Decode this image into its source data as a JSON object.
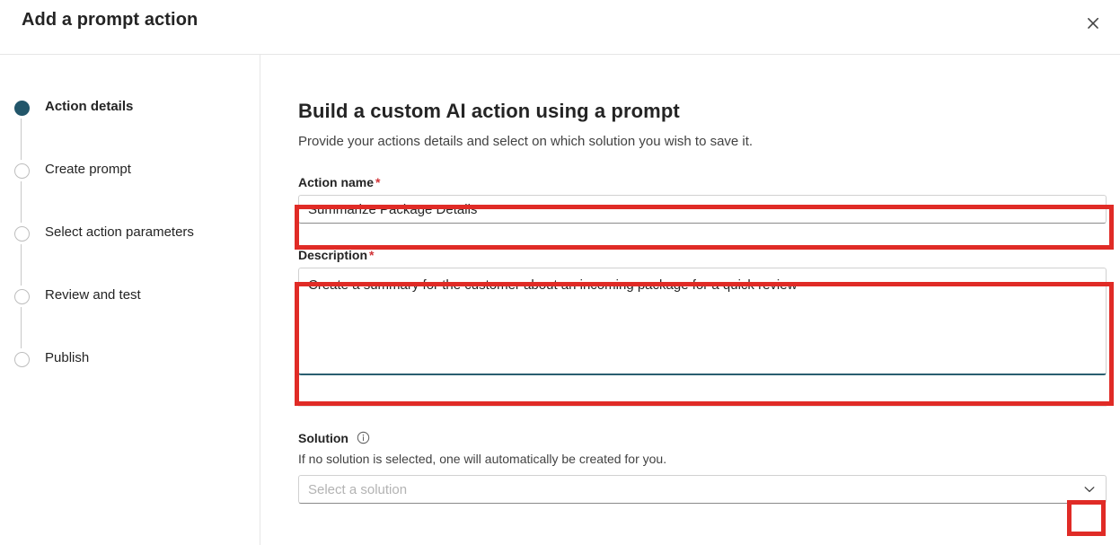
{
  "dialog": {
    "title": "Add a prompt action",
    "close_icon": "close-icon",
    "close_label": "Close"
  },
  "wizard": {
    "steps": [
      {
        "label": "Action details",
        "state": "active"
      },
      {
        "label": "Create prompt",
        "state": "pending"
      },
      {
        "label": "Select action parameters",
        "state": "pending"
      },
      {
        "label": "Review and test",
        "state": "pending"
      },
      {
        "label": "Publish",
        "state": "pending"
      }
    ]
  },
  "main": {
    "heading": "Build a custom AI action using a prompt",
    "subheading": "Provide your actions details and select on which solution you wish to save it.",
    "action_name": {
      "label": "Action name",
      "required_mark": "*",
      "value": "Summarize Package Details",
      "placeholder": ""
    },
    "description": {
      "label": "Description",
      "required_mark": "*",
      "value": "Create a summary for the customer about an incoming package for a quick review",
      "placeholder": ""
    },
    "solution": {
      "label": "Solution",
      "info_icon": "info-icon",
      "helper_text": "If no solution is selected, one will automatically be created for you.",
      "selected_value": "Select a solution",
      "chevron_icon": "chevron-down-icon"
    }
  },
  "annotations": {
    "color": "#e02b26",
    "highlighted": [
      "action-name-input",
      "description-textarea",
      "solution-dropdown-chevron"
    ]
  },
  "colors": {
    "brand_teal": "#22566a",
    "required_red": "#d13438",
    "annotation_red": "#e02b26",
    "text_primary": "#242424",
    "text_secondary": "#424242",
    "placeholder": "#b3b3b3",
    "border": "#d1d1d1",
    "divider": "#e6e6e6"
  }
}
